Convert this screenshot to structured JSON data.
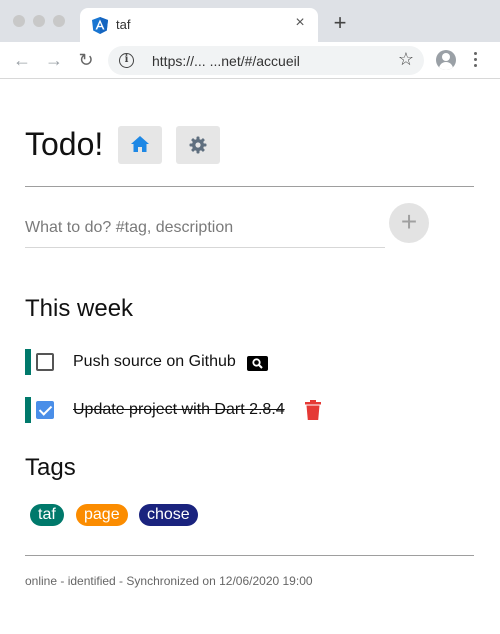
{
  "browser": {
    "tab_title": "taf",
    "tab_close": "×",
    "new_tab": "+",
    "url": "https://...  ...net/#/accueil",
    "back": "←",
    "forward": "→",
    "reload": "↻",
    "info": "i",
    "bookmark": "☆"
  },
  "header": {
    "title": "Todo!",
    "home_icon": "home-icon",
    "settings_icon": "gear-icon"
  },
  "new_todo": {
    "placeholder": "What to do? #tag, description",
    "add_label": "+"
  },
  "week": {
    "title": "This week",
    "todos": [
      {
        "text": "Push source on Github",
        "done": false,
        "tag_color": "#00796b",
        "action_icon": "search-icon"
      },
      {
        "text": "Update project with Dart 2.8.4",
        "done": true,
        "tag_color": "#00796b",
        "action_icon": "trash-icon"
      }
    ]
  },
  "tags": {
    "title": "Tags",
    "items": [
      {
        "label": "taf",
        "color": "#00796b"
      },
      {
        "label": "page",
        "color": "#fb8c00"
      },
      {
        "label": "chose",
        "color": "#1a237e"
      }
    ]
  },
  "status": "online - identified - Synchronized on 12/06/2020 19:00",
  "colors": {
    "accent_blue": "#1e88e5",
    "delete_red": "#e53935",
    "checkbox_blue": "#4a8ee8"
  }
}
